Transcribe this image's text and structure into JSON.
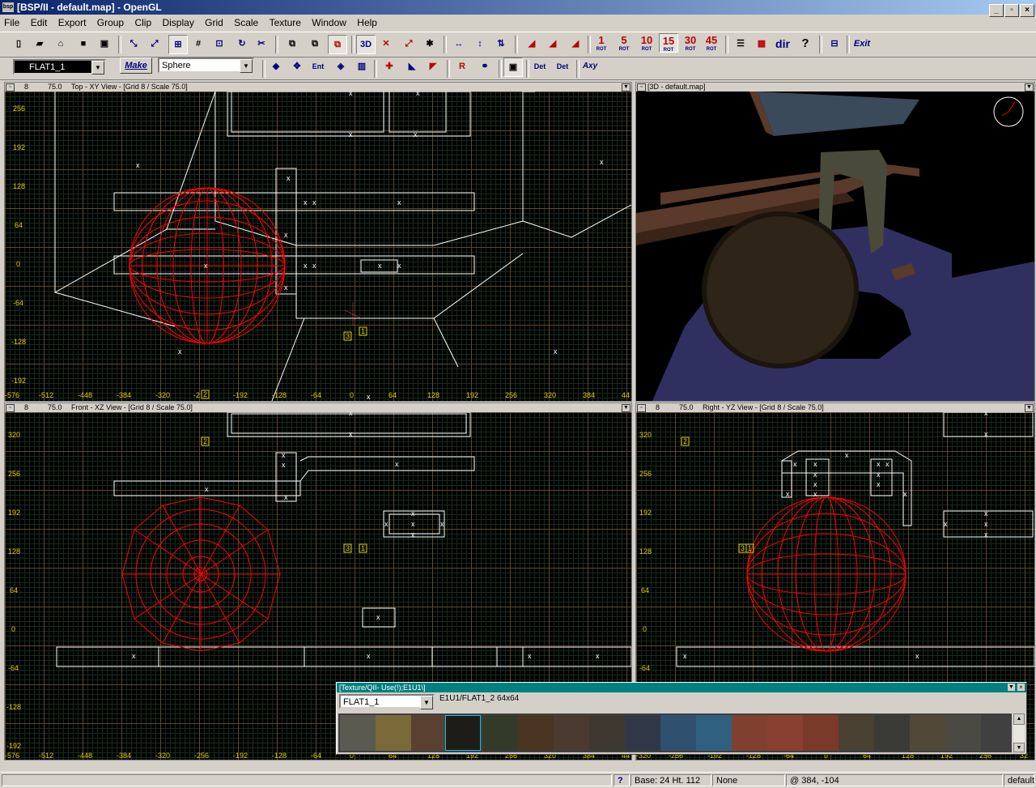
{
  "window": {
    "title": "[BSP/II - default.map] - OpenGL",
    "app_icon": "bsp"
  },
  "menu": [
    "File",
    "Edit",
    "Export",
    "Group",
    "Clip",
    "Display",
    "Grid",
    "Scale",
    "Texture",
    "Window",
    "Help"
  ],
  "toolbar": {
    "texture_combo": "FLAT1_1",
    "make_label": "Make",
    "shape_combo": "Sphere",
    "rot_buttons": [
      "1",
      "5",
      "10",
      "15",
      "30",
      "45"
    ],
    "rot_suffix": "ROT",
    "dir_label": "dir",
    "help_label": "?",
    "exit_label": "Exit",
    "det_label": "Det",
    "axy_label": "Axy"
  },
  "views": {
    "top": {
      "header_grid": "8",
      "header_scale": "75.0",
      "title": "Top - XY View - [Grid 8 / Scale 75.0]",
      "ylabels": [
        "256",
        "192",
        "128",
        "64",
        "0",
        "-64",
        "-128",
        "-192"
      ],
      "xlabels": [
        "-576",
        "-512",
        "-448",
        "-384",
        "-320",
        "-2",
        "-192",
        "-128",
        "-64",
        "0",
        "64",
        "128",
        "192",
        "256",
        "320",
        "384",
        "44"
      ],
      "entity_marks": [
        "2",
        "3",
        "1"
      ]
    },
    "threed": {
      "title": "[3D - default.map]"
    },
    "front": {
      "header_grid": "8",
      "header_scale": "75.0",
      "title": "Front - XZ View - [Grid 8 / Scale 75.0]",
      "ylabels": [
        "320",
        "256",
        "192",
        "128",
        "64",
        "0",
        "-64",
        "-128",
        "-192"
      ],
      "xlabels": [
        "-576",
        "-512",
        "-448",
        "-384",
        "-320",
        "-256",
        "-192",
        "-128",
        "-64",
        "0",
        "64",
        "128",
        "192",
        "256",
        "320",
        "384",
        "44"
      ],
      "entity_marks": [
        "2",
        "3",
        "1"
      ]
    },
    "right": {
      "header_grid": "8",
      "header_scale": "75.0",
      "title": "Right - YZ View - [Grid 8 / Scale 75.0]",
      "ylabels": [
        "320",
        "256",
        "192",
        "128",
        "64",
        "0",
        "-64"
      ],
      "xlabels": [
        "-320",
        "-256",
        "-192",
        "-128",
        "-64",
        "0",
        "64",
        "128",
        "192",
        "256",
        "32"
      ],
      "entity_marks": [
        "2",
        "3",
        "1"
      ]
    }
  },
  "texture_window": {
    "title": "[Texture/QII- Use(!);E1U1\\]",
    "selected_combo": "FLAT1_1",
    "info": "E1U1/FLAT1_2 64x64"
  },
  "status": {
    "help": "?",
    "base": "Base: 24 Ht. 112",
    "mode": "None",
    "coords": "@  384, -104",
    "group": "default"
  },
  "colors": {
    "grid_major": "#5a4a2a",
    "brush": "#ffffff",
    "selected": "#ff0000",
    "labels": "#e0d000",
    "title_start": "#0a246a"
  }
}
